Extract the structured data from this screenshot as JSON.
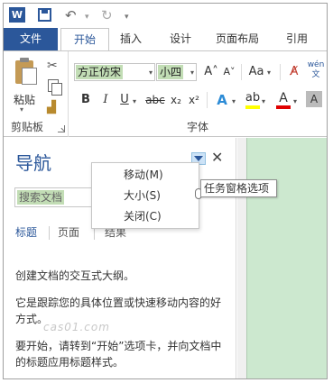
{
  "titlebar": {
    "word_icon_letter": "W",
    "save_icon": "save-icon",
    "undo_icon": "↶",
    "redo_icon": "↻",
    "dropdown_glyph": "▾"
  },
  "tabs": [
    {
      "label": "文件"
    },
    {
      "label": "开始"
    },
    {
      "label": "插入"
    },
    {
      "label": "设计"
    },
    {
      "label": "页面布局"
    },
    {
      "label": "引用"
    }
  ],
  "ribbon": {
    "clipboard": {
      "paste_label": "粘贴",
      "cut_glyph": "✂",
      "painter_glyph": "🖌",
      "group_label": "剪贴板"
    },
    "font": {
      "font_name": "方正仿宋",
      "font_size": "小四",
      "grow_glyph": "A˄",
      "shrink_glyph": "A˅",
      "case_glyph": "Aa",
      "clear_glyph": "A̸",
      "phonetic_top": "wén",
      "phonetic_bottom": "文",
      "bold": "B",
      "italic": "I",
      "underline": "U",
      "strike": "abc",
      "subscript": "x₂",
      "superscript": "x²",
      "effects": "A",
      "highlight": "ab",
      "font_color": "A",
      "char_shade": "A",
      "group_label": "字体",
      "highlight_color": "#ffff00",
      "font_color_value": "#e00000"
    }
  },
  "nav_pane": {
    "title": "导航",
    "close_glyph": "✕",
    "search_placeholder": "搜索文档",
    "tabs": [
      {
        "label": "标题"
      },
      {
        "label": "页面"
      },
      {
        "label": "结果"
      }
    ],
    "para1": "创建文档的交互式大纲。",
    "para2": "它是跟踪您的具体位置或快速移动内容的好方式。",
    "para3": "要开始，请转到“开始”选项卡，并向文档中的标题应用标题样式。",
    "watermark": "cas01.com"
  },
  "menu": {
    "items": [
      {
        "label": "移动(M)"
      },
      {
        "label": "大小(S)"
      },
      {
        "label": "关闭(C)"
      }
    ]
  },
  "tooltip": {
    "text": "任务窗格选项"
  },
  "colors": {
    "accent": "#2b579a",
    "selection_green": "#c2ddb5",
    "doc_page": "#cce8cf"
  }
}
